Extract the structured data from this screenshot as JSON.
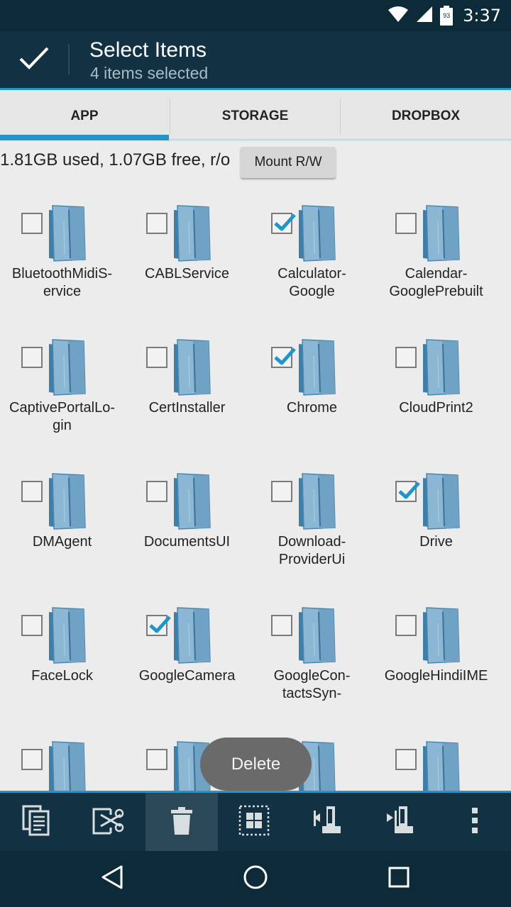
{
  "status_bar": {
    "time": "3:37",
    "battery_level": "93",
    "icons": [
      "wifi-icon",
      "signal-icon",
      "battery-icon"
    ]
  },
  "action_bar": {
    "title": "Select Items",
    "subtitle": "4 items selected",
    "done_icon": "checkmark-icon"
  },
  "tabs": [
    {
      "label": "APP",
      "selected": true
    },
    {
      "label": "STORAGE",
      "selected": false
    },
    {
      "label": "DROPBOX",
      "selected": false
    }
  ],
  "info": {
    "storage_text": "1.81GB used, 1.07GB free, r/o",
    "mount_button": "Mount R/W"
  },
  "items": [
    {
      "name": "BluetoothMidiS-\nervice",
      "checked": false
    },
    {
      "name": "CABLService",
      "checked": false
    },
    {
      "name": "Calculator-\nGoogle",
      "checked": true
    },
    {
      "name": "Calendar-\nGooglePrebuilt",
      "checked": false
    },
    {
      "name": "CaptivePortalLo-\ngin",
      "checked": false
    },
    {
      "name": "CertInstaller",
      "checked": false
    },
    {
      "name": "Chrome",
      "checked": true
    },
    {
      "name": "CloudPrint2",
      "checked": false
    },
    {
      "name": "DMAgent",
      "checked": false
    },
    {
      "name": "DocumentsUI",
      "checked": false
    },
    {
      "name": "Download-\nProviderUi",
      "checked": false
    },
    {
      "name": "Drive",
      "checked": true
    },
    {
      "name": "FaceLock",
      "checked": false
    },
    {
      "name": "GoogleCamera",
      "checked": true
    },
    {
      "name": "GoogleCon-\ntactsSyn-",
      "checked": false
    },
    {
      "name": "GoogleHindiIME",
      "checked": false
    },
    {
      "name": "",
      "checked": false
    },
    {
      "name": "",
      "checked": false
    },
    {
      "name": "",
      "checked": false
    },
    {
      "name": "",
      "checked": false
    }
  ],
  "toast": {
    "text": "Delete"
  },
  "toolbar": {
    "buttons": [
      "copy-icon",
      "cut-icon",
      "delete-icon",
      "select-all-icon",
      "compress-icon",
      "extract-icon",
      "overflow-menu-icon"
    ],
    "active": "delete-icon"
  },
  "nav": {
    "buttons": [
      "back-icon",
      "home-icon",
      "recents-icon"
    ]
  },
  "colors": {
    "accent": "#1f96c9",
    "action_bar": "#123243",
    "status_bar": "#0d2a38",
    "background": "#ececec"
  }
}
